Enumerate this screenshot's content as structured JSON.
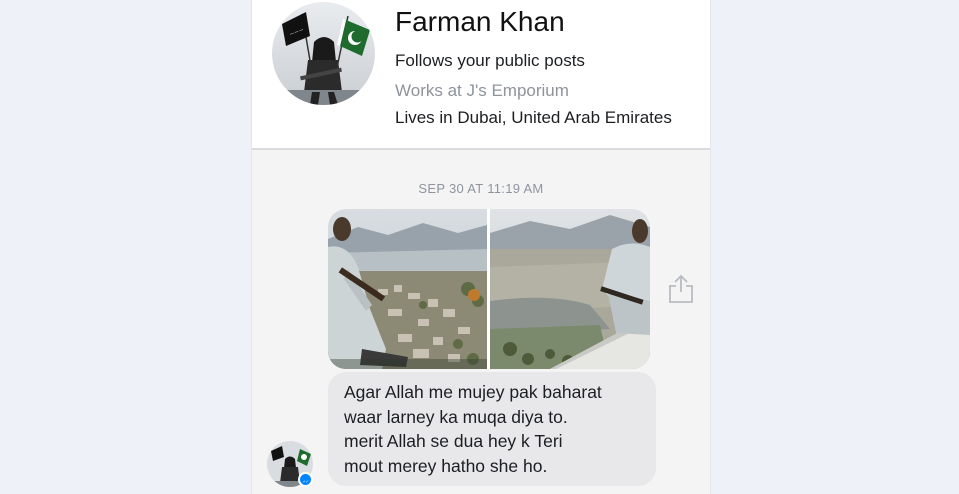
{
  "profile": {
    "name": "Farman Khan",
    "follows": "Follows your public posts",
    "work": "Works at J's Emporium",
    "location": "Lives in Dubai, United Arab Emirates"
  },
  "conversation": {
    "timestamp": "SEP 30 AT 11:19 AM",
    "photo_count": 2,
    "message_lines": [
      "Agar Allah me mujey pak baharat",
      "waar larney ka muqa diya to.",
      "merit Allah se dua hey k Teri",
      "mout merey hatho she ho."
    ]
  },
  "icons": {
    "share": "share-icon",
    "messenger_badge": "messenger-badge-icon"
  },
  "colors": {
    "page_background": "#eef1f7",
    "bubble_background": "#e8e8ea",
    "secondary_text": "#8d949e",
    "messenger_blue": "#0084ff",
    "flag_green": "#1f6b2e"
  }
}
